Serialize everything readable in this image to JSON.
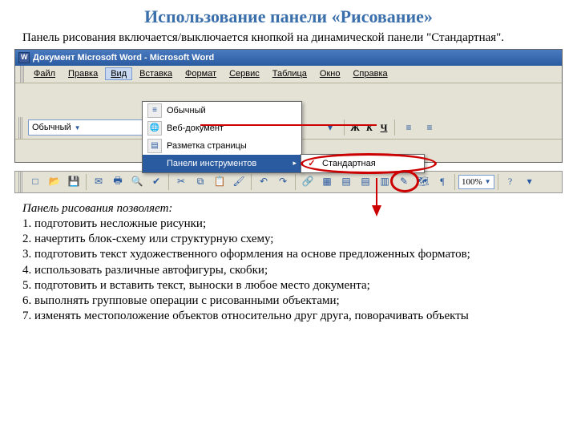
{
  "slide": {
    "title": "Использование панели «Рисование»",
    "intro": "Панель рисования включается/выключается кнопкой на динамической панели \"Стандартная\"."
  },
  "titlebar": {
    "text": "Документ Microsoft Word - Microsoft Word"
  },
  "menubar": {
    "file": "Файл",
    "edit": "Правка",
    "view": "Вид",
    "insert": "Вставка",
    "format": "Формат",
    "service": "Сервис",
    "table": "Таблица",
    "window": "Окно",
    "help": "Справка"
  },
  "view_menu": {
    "normal": "Обычный",
    "web": "Веб-документ",
    "page_layout": "Разметка страницы",
    "toolbars": "Панели инструментов"
  },
  "submenu": {
    "standard": "Стандартная"
  },
  "fmt": {
    "style": "Обычный",
    "bold": "Ж",
    "italic": "К",
    "underline": "Ч"
  },
  "std": {
    "zoom": "100%"
  },
  "body": {
    "lead": "Панель рисования позволяет:",
    "items": [
      "подготовить несложные рисунки;",
      "начертить блок-схему или структурную схему;",
      "подготовить текст художественного оформления на основе предложенных форматов;",
      "использовать различные автофигуры, скобки;",
      "подготовить и вставить текст, выноски в любое место документа;",
      "выполнять групповые операции с рисованными объектами;",
      "изменять местоположение объектов относительно друг друга, поворачивать объекты"
    ]
  },
  "icons": {
    "new": "□",
    "open": "📂",
    "save": "💾",
    "mail": "✉",
    "print": "🖶",
    "preview": "🔍",
    "spell": "✔",
    "cut": "✂",
    "copy": "⧉",
    "paste": "📋",
    "fmtbrush": "🖌",
    "undo": "↶",
    "redo": "↷",
    "link": "🔗",
    "tables": "▦",
    "excel": "▤",
    "cols": "▥",
    "draw": "✎",
    "map": "🗺",
    "para": "¶",
    "help": "?",
    "normal": "≡",
    "web": "🌐",
    "layout": "▤",
    "arrow": "▸",
    "check": "✓",
    "align_l": "≡",
    "align_r": "≡"
  }
}
